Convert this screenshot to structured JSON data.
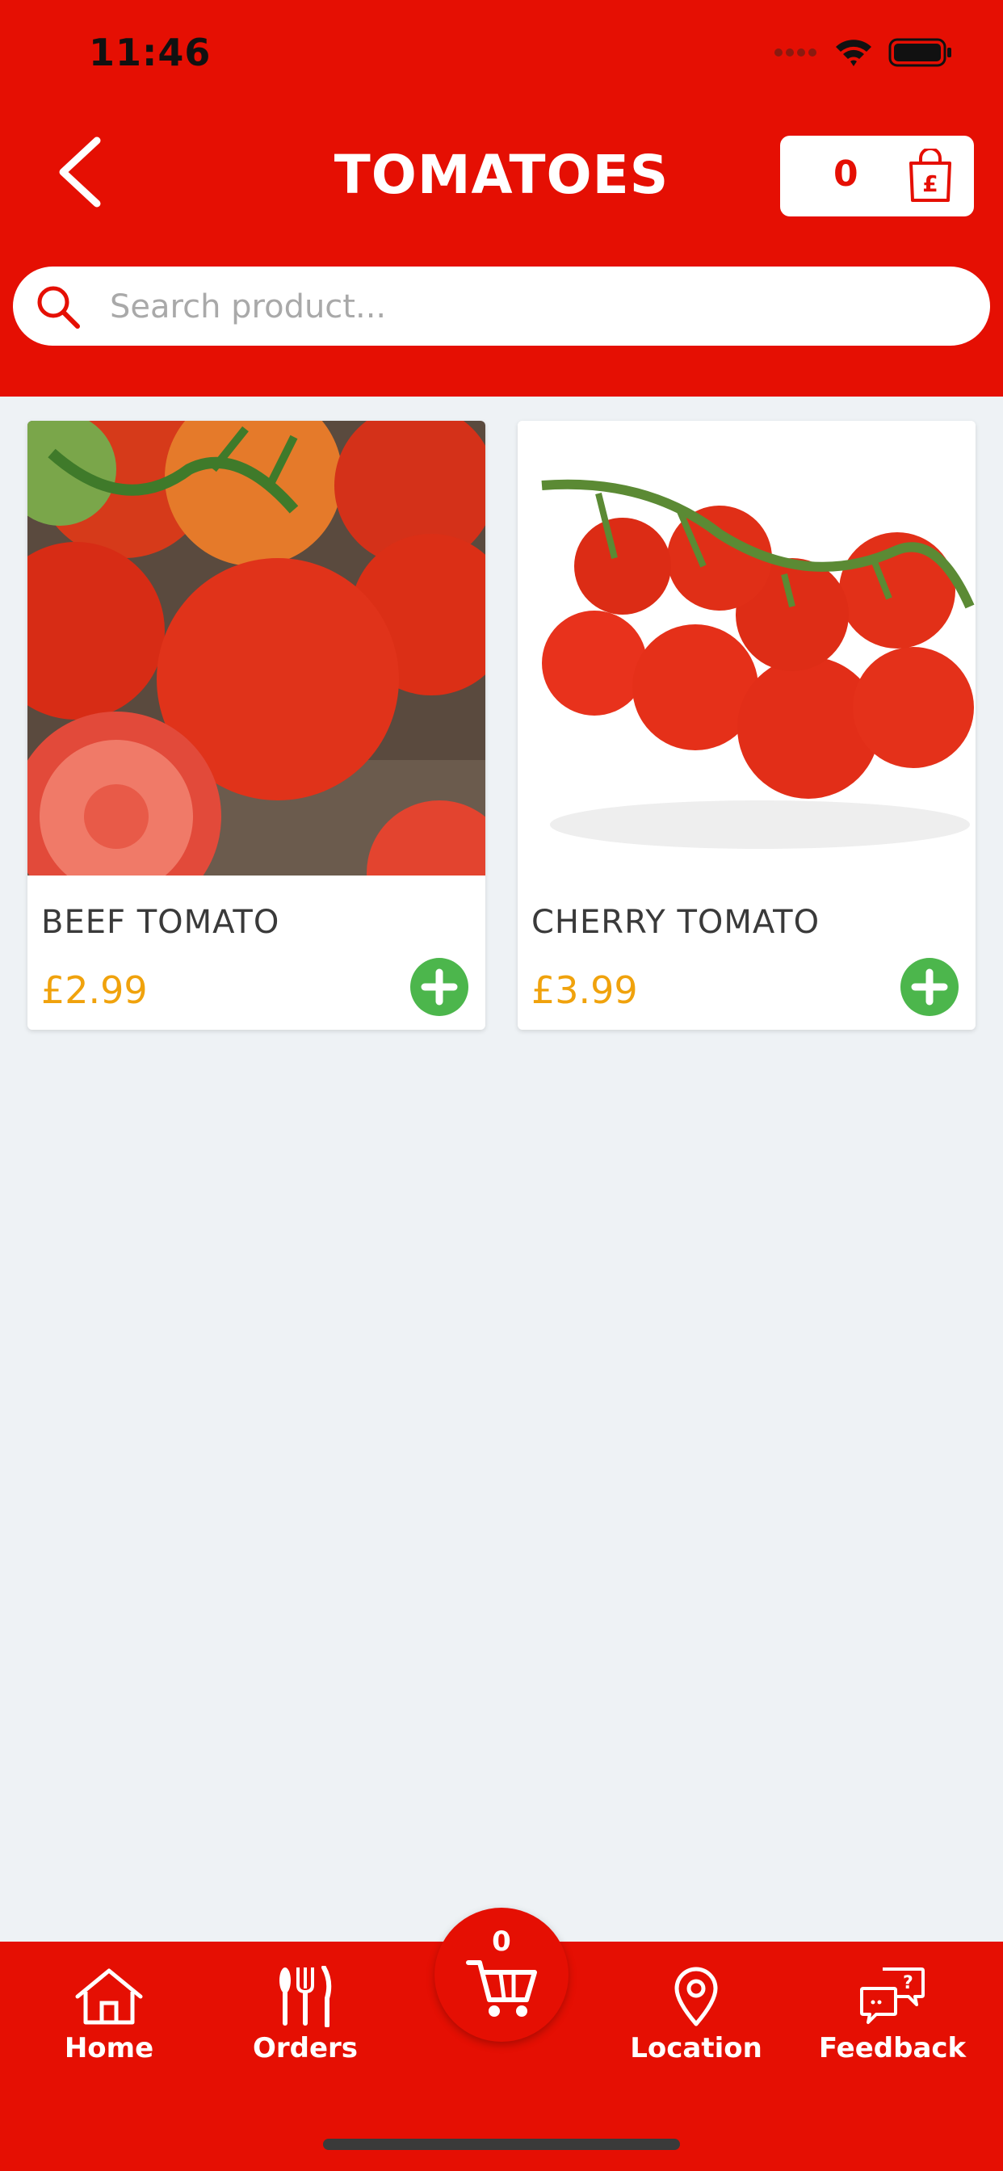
{
  "status_bar": {
    "time": "11:46"
  },
  "header": {
    "title": "TOMATOES",
    "cart_count": "0"
  },
  "search": {
    "placeholder": "Search product..."
  },
  "products": [
    {
      "name": "BEEF TOMATO",
      "price": "£2.99"
    },
    {
      "name": "CHERRY TOMATO",
      "price": "£3.99"
    }
  ],
  "bottom_nav": {
    "items": [
      {
        "label": "Home",
        "icon": "home-icon"
      },
      {
        "label": "Orders",
        "icon": "cutlery-icon"
      },
      {
        "label": "Location",
        "icon": "location-pin-icon"
      },
      {
        "label": "Feedback",
        "icon": "feedback-icon"
      }
    ],
    "cart_count": "0"
  },
  "colors": {
    "brand": "#e50f03",
    "price": "#f0a20c",
    "add_button": "#4cb64c",
    "background": "#eef2f5"
  }
}
